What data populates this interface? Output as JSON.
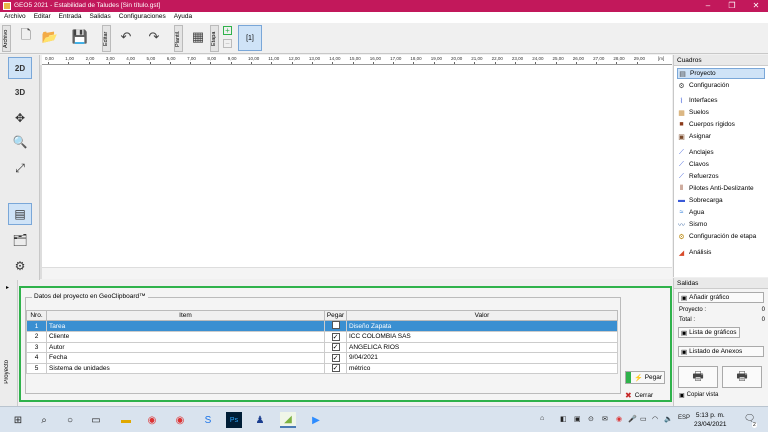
{
  "window": {
    "title": "GEO5 2021 - Estabilidad de Taludes [Sin título.gst]",
    "accent": "#c2185b"
  },
  "menu": [
    "Archivo",
    "Editar",
    "Entrada",
    "Salidas",
    "Configuraciones",
    "Ayuda"
  ],
  "toolbar": {
    "archivo_label": "Archivo",
    "editar_label": "Editar",
    "plantilla_label": "Plantil.",
    "etapa_label": "Etapa",
    "stage_number": "[1]"
  },
  "left_tools": [
    "2D",
    "3D",
    "move-icon",
    "zoom-icon",
    "fit-icon",
    "table-icon",
    "data-icon",
    "settings-icon"
  ],
  "ruler": {
    "ticks": [
      "0,00",
      "1,00",
      "2,00",
      "3,00",
      "4,00",
      "5,00",
      "6,00",
      "7,00",
      "8,00",
      "9,00",
      "10,00",
      "11,00",
      "12,00",
      "13,00",
      "14,00",
      "15,00",
      "16,00",
      "17,00",
      "18,00",
      "19,00",
      "20,00",
      "21,00",
      "22,00",
      "23,00",
      "24,00",
      "25,00",
      "26,00",
      "27,00",
      "28,00",
      "29,00"
    ],
    "unit": "[m]"
  },
  "frames": {
    "title": "Cuadros",
    "items": [
      {
        "label": "Proyecto",
        "icon": "list-icon",
        "selected": true
      },
      {
        "label": "Configuración",
        "icon": "gear-icon"
      },
      {
        "label": "Interfaces",
        "icon": "interfaces-icon"
      },
      {
        "label": "Suelos",
        "icon": "soil-icon"
      },
      {
        "label": "Cuerpos rígidos",
        "icon": "rigid-body-icon"
      },
      {
        "label": "Asignar",
        "icon": "assign-icon"
      },
      {
        "label": "Anclajes",
        "icon": "anchor-icon"
      },
      {
        "label": "Clavos",
        "icon": "nail-icon"
      },
      {
        "label": "Refuerzos",
        "icon": "reinforcement-icon"
      },
      {
        "label": "Pilotes Anti-Deslizante",
        "icon": "pile-icon"
      },
      {
        "label": "Sobrecarga",
        "icon": "surcharge-icon"
      },
      {
        "label": "Agua",
        "icon": "water-icon"
      },
      {
        "label": "Sismo",
        "icon": "earthquake-icon"
      },
      {
        "label": "Configuración de etapa",
        "icon": "stage-settings-icon"
      },
      {
        "label": "Análisis",
        "icon": "analysis-icon"
      }
    ]
  },
  "project_panel": {
    "side_label": "Proyecto",
    "legend": "Datos del proyecto en GeoClipboard™",
    "columns": {
      "nro": "Nro.",
      "item": "Item",
      "pegar": "Pegar",
      "valor": "Valor"
    },
    "rows": [
      {
        "nro": "1",
        "item": "Tarea",
        "checked": false,
        "valor": "Diseño Zapata",
        "selected": true
      },
      {
        "nro": "2",
        "item": "Cliente",
        "checked": true,
        "valor": "ICC COLOMBIA SAS"
      },
      {
        "nro": "3",
        "item": "Autor",
        "checked": true,
        "valor": "ANGELICA RIOS"
      },
      {
        "nro": "4",
        "item": "Fecha",
        "checked": true,
        "valor": "9/04/2021"
      },
      {
        "nro": "5",
        "item": "Sistema de unidades",
        "checked": true,
        "valor": "métrico"
      }
    ],
    "pegar_button": "Pegar",
    "cerrar_button": "Cerrar",
    "highlight": "#2fb24b"
  },
  "outputs": {
    "title": "Salidas",
    "add_graphic": "Añadir gráfico",
    "proyecto_label": "Proyecto :",
    "proyecto_count": "0",
    "total_label": "Total :",
    "total_count": "0",
    "graphics_list": "Lista de gráficos",
    "annex_list": "Listado de Anexos",
    "copy_view": "Copiar vista"
  },
  "taskbar": {
    "lang": "ESP",
    "time": "5:13 p. m.",
    "date": "23/04/2021",
    "notif_count": "2"
  }
}
